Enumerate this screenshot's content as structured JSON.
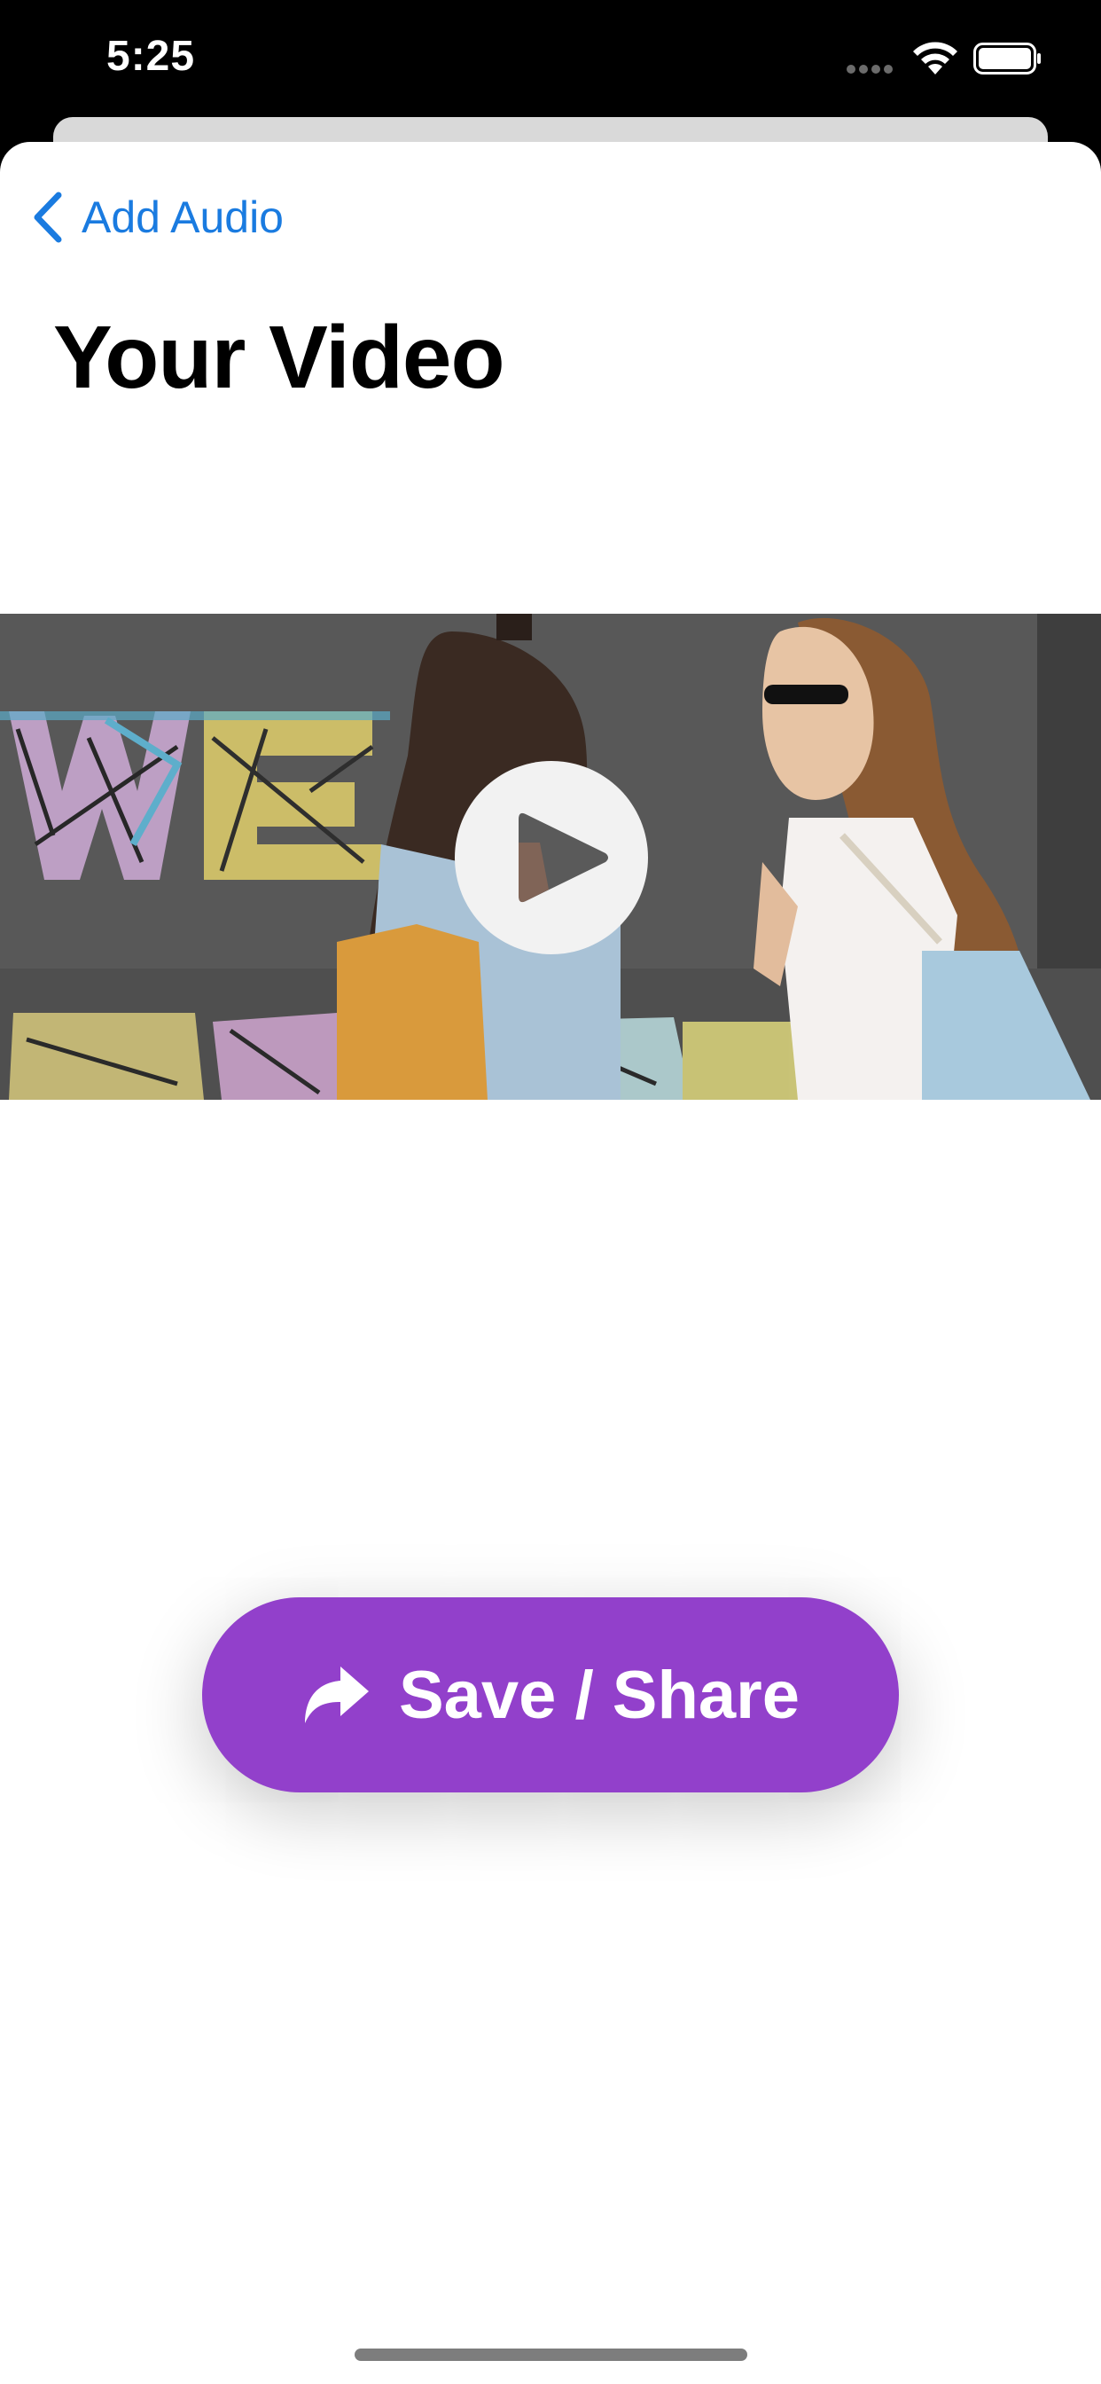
{
  "status_bar": {
    "time": "5:25",
    "icons": [
      "signal-icon",
      "wifi-icon",
      "battery-icon"
    ]
  },
  "nav": {
    "back_label": "Add Audio",
    "back_icon": "chevron-left-icon"
  },
  "page": {
    "title": "Your Video"
  },
  "video": {
    "play_icon": "play-icon",
    "thumbnail": "two women walking past a graffiti wall"
  },
  "actions": {
    "save_share_label": "Save / Share",
    "save_share_icon": "share-arrow-icon"
  },
  "colors": {
    "accent_link": "#1a7be0",
    "button_purple": "#9240cb",
    "background": "#ffffff"
  }
}
